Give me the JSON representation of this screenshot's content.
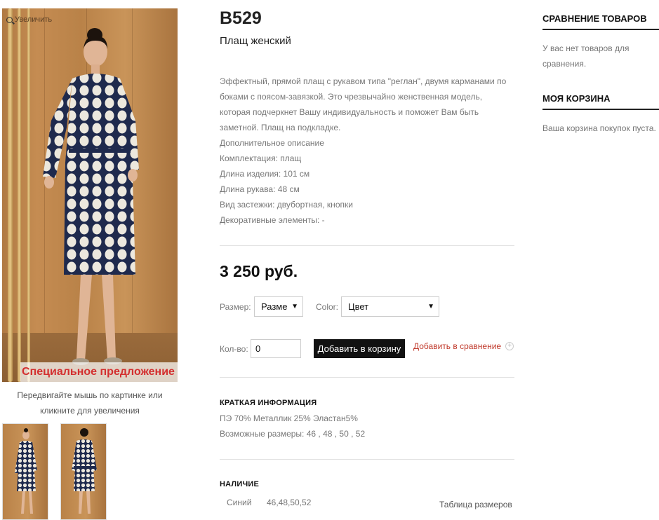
{
  "gallery": {
    "zoom_label": "Увеличить",
    "special_offer": "Специальное предложение",
    "hover_hint": "Передвигайте мышь по картинке или кликните для увеличения"
  },
  "product": {
    "sku": "B529",
    "name": "Плащ женский",
    "description": [
      "Эффектный, прямой плащ с рукавом типа \"реглан\", двумя карманами по",
      "боками с поясом-завязкой. Это чрезвычайно женственная модель,",
      "которая подчеркнет Вашу индивидуальность и поможет Вам быть",
      "заметной. Плащ на подкладке.",
      "Дополнительное описание",
      "Комплектация: плащ",
      "Длина изделия: 101 см",
      "Длина рукава: 48 см",
      "Вид застежки: двубортная, кнопки",
      "Декоративные элементы: -"
    ],
    "price": "3 250 руб."
  },
  "options": {
    "size_label": "Размер:",
    "size_value": "Разме",
    "color_label": "Color:",
    "color_value": "Цвет",
    "qty_label": "Кол-во:",
    "qty_value": "0",
    "add_to_cart": "Добавить в корзину",
    "add_to_compare": "Добавить в сравнение"
  },
  "brief": {
    "title": "КРАТКАЯ ИНФОРМАЦИЯ",
    "composition": "ПЭ 70% Металлик 25% Эластан5%",
    "sizes": "Возможные размеры: 46 , 48 , 50 , 52"
  },
  "stock": {
    "title": "НАЛИЧИЕ",
    "color": "Синий",
    "sizes": "46,48,50,52",
    "size_table": "Таблица размеров"
  },
  "sidebar": {
    "compare_title": "СРАВНЕНИЕ ТОВАРОВ",
    "compare_empty": "У вас нет товаров для сравнения.",
    "cart_title": "МОЯ КОРЗИНА",
    "cart_empty": "Ваша корзина покупок пуста."
  },
  "colors": {
    "accent_red": "#d32f2f",
    "button_black": "#111111",
    "coat_navy": "#1f2a4d"
  }
}
